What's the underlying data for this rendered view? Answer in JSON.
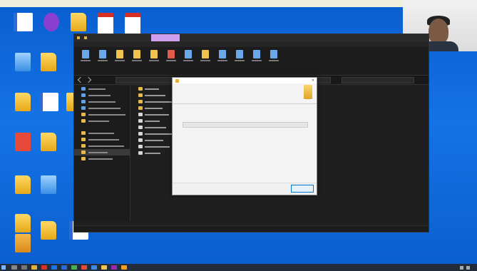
{
  "webcam": {
    "participant_name": ""
  },
  "desktop": {
    "icons": [
      {
        "label": "",
        "type": "doc"
      },
      {
        "label": "",
        "type": "app"
      },
      {
        "label": "",
        "type": "folder"
      },
      {
        "label": "",
        "type": "pdf"
      },
      {
        "label": "",
        "type": "pdf"
      },
      {
        "label": "",
        "type": "pc"
      },
      {
        "label": "",
        "type": "folder"
      },
      {
        "label": "",
        "type": "folder"
      },
      {
        "label": "",
        "type": "doc"
      },
      {
        "label": "",
        "type": "folder"
      },
      {
        "label": "",
        "type": "red"
      },
      {
        "label": "",
        "type": "folder"
      },
      {
        "label": "",
        "type": "folder"
      },
      {
        "label": "",
        "type": "pc"
      },
      {
        "label": "",
        "type": "folder"
      },
      {
        "label": "",
        "type": "tile"
      },
      {
        "label": "",
        "type": "folder"
      },
      {
        "label": "",
        "type": "doc"
      }
    ]
  },
  "explorer": {
    "active_tab": "",
    "ribbon_tabs": [
      "",
      "",
      "",
      ""
    ],
    "nav_items": [
      "",
      "",
      "",
      "",
      "",
      "",
      "",
      "",
      "",
      "",
      ""
    ],
    "files": [
      "",
      "",
      "",
      "",
      "",
      "",
      "",
      "",
      "",
      "",
      ""
    ]
  },
  "dialog": {
    "title": "",
    "heading": "",
    "subtitle": "",
    "progress": 0,
    "back_label": "",
    "cancel_label": ""
  },
  "taskbar": {
    "clock": ""
  },
  "colors": {
    "desktop_blue": "#1473e6",
    "accent": "#0078d7",
    "progress_green": "#06b025",
    "explorer_dark": "#1f1f1f"
  }
}
